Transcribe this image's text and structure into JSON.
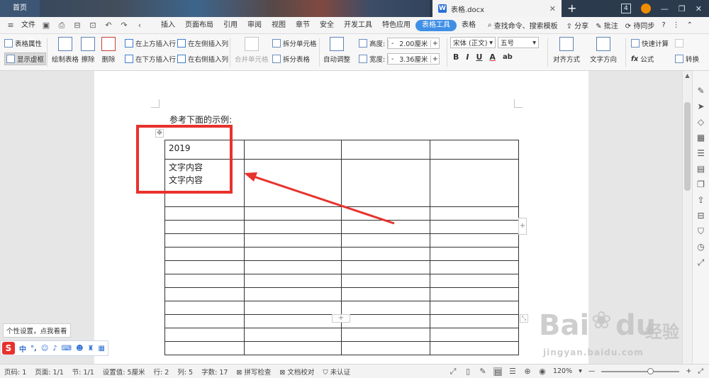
{
  "titlebar": {
    "home_tab": "首页",
    "doc_tab": "表格.docx",
    "doc_icon_letter": "W",
    "close_glyph": "✕",
    "new_tab_glyph": "+",
    "badge": "4",
    "min_glyph": "—",
    "restore_glyph": "❐",
    "close_window_glyph": "✕"
  },
  "menubar": {
    "file_label": "文件",
    "tabs": [
      "插入",
      "页面布局",
      "引用",
      "审阅",
      "视图",
      "章节",
      "安全",
      "开发工具",
      "特色应用",
      "表格工具",
      "表格"
    ],
    "active_tab": "表格工具",
    "search_label": "查找命令、搜索模板",
    "share_label": "分享",
    "comment_label": "批注",
    "sync_label": "待同步",
    "help_glyph": "?"
  },
  "ribbon": {
    "table_props": "表格属性",
    "show_gridlines": "显示虚框",
    "draw_table": "绘制表格",
    "erase": "擦除",
    "delete": "删除",
    "insert_above": "在上方插入行",
    "insert_below": "在下方插入行",
    "insert_left": "在左侧插入列",
    "insert_right": "在右侧插入列",
    "merge_cells": "合并单元格",
    "split_cells": "拆分单元格",
    "split_table": "拆分表格",
    "auto_fit": "自动调整",
    "height_label": "高度:",
    "height_value": "2.00厘米",
    "width_label": "宽度:",
    "width_value": "3.36厘米",
    "font_name": "宋体 (正文)",
    "font_size": "五号",
    "align": "对齐方式",
    "text_dir": "文字方向",
    "quick_calc": "快速计算",
    "formula": "公式",
    "convert": "转换"
  },
  "document": {
    "intro": "参考下面的示例:",
    "table": {
      "rows": 13,
      "cols": 4,
      "cell_r0_c0": "2019",
      "cell_r1_c0_line1": "文字内容",
      "cell_r1_c0_line2": "文字内容"
    }
  },
  "ime": {
    "tip": "个性设置，点我看看",
    "logo": "S",
    "lang": "中"
  },
  "watermark": {
    "text": "Bai",
    "du": "du",
    "cn": "经验",
    "url": "jingyan.baidu.com"
  },
  "statusbar": {
    "page_code": "页码: 1",
    "pages": "页面: 1/1",
    "section": "节: 1/1",
    "set_value": "设置值: 5厘米",
    "row": "行: 2",
    "col": "列: 5",
    "words": "字数: 17",
    "spell_check": "拼写检查",
    "doc_proof": "文档校对",
    "auth": "未认证",
    "zoom": "120%",
    "zoom_minus": "—",
    "zoom_plus": "+"
  },
  "colors": {
    "accent": "#3f8fe6",
    "highlight": "#e8322d",
    "titlebar": "#2b3a4d"
  },
  "zoom_level": 0.62
}
